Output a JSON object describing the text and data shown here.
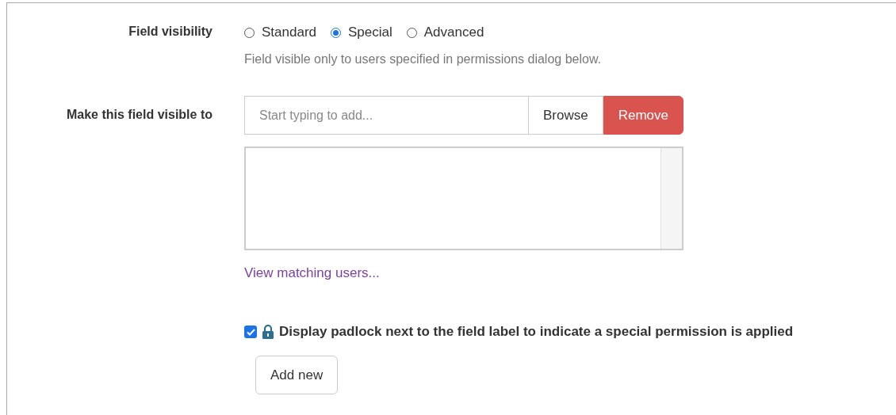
{
  "visibility": {
    "label": "Field visibility",
    "options": [
      {
        "label": "Standard",
        "selected": false
      },
      {
        "label": "Special",
        "selected": true
      },
      {
        "label": "Advanced",
        "selected": false
      }
    ],
    "hint": "Field visible only to users specified in permissions dialog below."
  },
  "visible_to": {
    "label": "Make this field visible to",
    "placeholder": "Start typing to add...",
    "buttons": [
      {
        "label": "Browse",
        "kind": "default"
      },
      {
        "label": "Remove",
        "kind": "danger"
      }
    ],
    "link": "View matching users..."
  },
  "padlock": {
    "checked": true,
    "label": "Display padlock next to the field label to indicate a special permission is applied"
  },
  "add_button": "Add new"
}
